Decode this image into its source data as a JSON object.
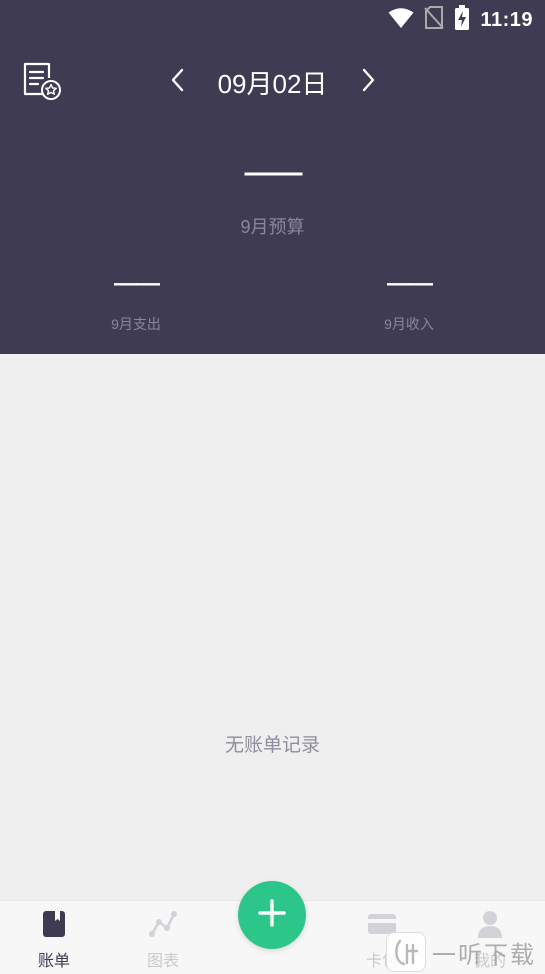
{
  "status_bar": {
    "time": "11:19",
    "icons": [
      "wifi-icon",
      "no-sim-icon",
      "battery-charging-icon"
    ]
  },
  "header": {
    "doc_icon": "document-star-icon",
    "prev_icon": "chevron-left-icon",
    "next_icon": "chevron-right-icon",
    "date": "09月02日",
    "budget_value": "——",
    "budget_label": "9月预算",
    "expense_value": "——",
    "expense_label": "9月支出",
    "income_value": "——",
    "income_label": "9月收入"
  },
  "main": {
    "empty_text": "无账单记录"
  },
  "tabbar": {
    "tabs": [
      {
        "label": "账单",
        "icon": "book-icon",
        "active": true
      },
      {
        "label": "图表",
        "icon": "line-chart-icon",
        "active": false
      },
      {
        "label": "卡包",
        "icon": "card-icon",
        "active": false
      },
      {
        "label": "我的",
        "icon": "person-icon",
        "active": false
      }
    ],
    "add_icon": "plus-icon"
  },
  "watermark": {
    "text": "一听下载"
  },
  "colors": {
    "header_bg": "#3f3b52",
    "accent": "#2cc68a",
    "page_bg": "#efefef"
  }
}
